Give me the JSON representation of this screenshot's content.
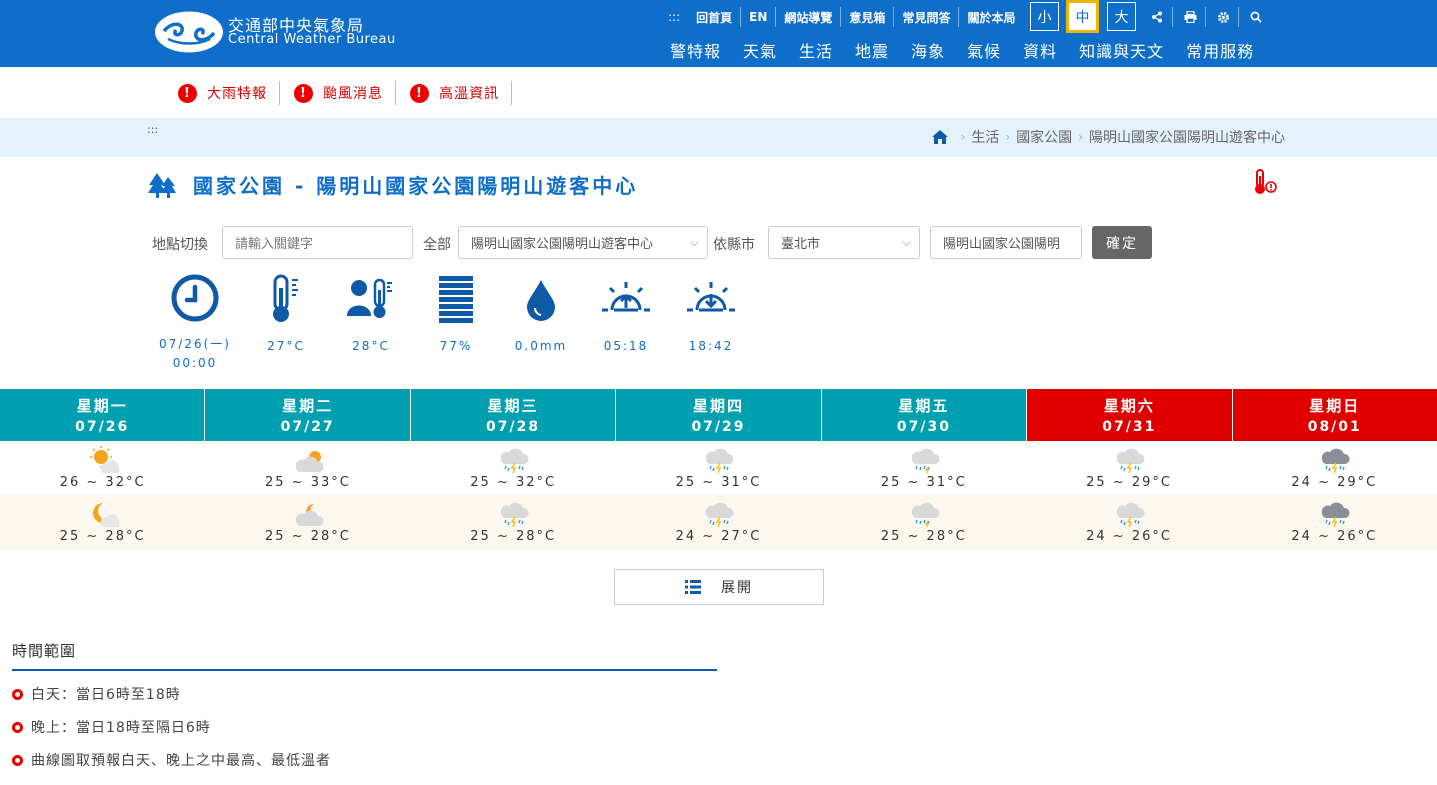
{
  "header": {
    "logo_zh": "交通部中央氣象局",
    "logo_en": "Central Weather Bureau",
    "accesskey": ":::",
    "top_links": [
      "回首頁",
      "EN",
      "網站導覽",
      "意見箱",
      "常見問答",
      "關於本局"
    ],
    "font_sizes": [
      "小",
      "中",
      "大"
    ],
    "active_font_size": "中",
    "tools": [
      "share-icon",
      "print-icon",
      "settings-icon",
      "search-icon"
    ],
    "main_nav": [
      "警特報",
      "天氣",
      "生活",
      "地震",
      "海象",
      "氣候",
      "資料",
      "知識與天文",
      "常用服務"
    ]
  },
  "alerts": [
    "大雨特報",
    "颱風消息",
    "高溫資訊"
  ],
  "breadcrumb": {
    "accesskey": ":::",
    "items": [
      "生活",
      "國家公園",
      "陽明山國家公園陽明山遊客中心"
    ]
  },
  "page": {
    "title": "國家公園 - 陽明山國家公園陽明山遊客中心"
  },
  "selector": {
    "label_location": "地點切換",
    "search_placeholder": "請輸入關鍵字",
    "label_all": "全部",
    "all_value": "陽明山國家公園陽明山遊客中心",
    "label_county": "依縣市",
    "county_value": "臺北市",
    "site_value": "陽明山國家公園陽明",
    "confirm_label": "確定"
  },
  "current": {
    "time": "07/26(一)",
    "time2": "00:00",
    "temp": "27°C",
    "feels_like": "28°C",
    "humidity": "77%",
    "rain": "0.0mm",
    "sunrise": "05:18",
    "sunset": "18:42"
  },
  "forecast": {
    "days": [
      {
        "name": "星期一",
        "date": "07/26",
        "weekend": false,
        "day_icon": "sunny-cloudy-icon",
        "day_temp": "26 ~ 32°C",
        "night_icon": "moon-cloudy-icon",
        "night_temp": "25 ~ 28°C"
      },
      {
        "name": "星期二",
        "date": "07/27",
        "weekend": false,
        "day_icon": "cloudy-sun-icon",
        "day_temp": "25 ~ 33°C",
        "night_icon": "cloudy-moon-icon",
        "night_temp": "25 ~ 28°C"
      },
      {
        "name": "星期三",
        "date": "07/28",
        "weekend": false,
        "day_icon": "thunder-rain-icon",
        "day_temp": "25 ~ 32°C",
        "night_icon": "thunder-rain-icon",
        "night_temp": "25 ~ 28°C"
      },
      {
        "name": "星期四",
        "date": "07/29",
        "weekend": false,
        "day_icon": "thunder-rain-icon",
        "day_temp": "25 ~ 31°C",
        "night_icon": "thunder-rain-icon",
        "night_temp": "24 ~ 27°C"
      },
      {
        "name": "星期五",
        "date": "07/30",
        "weekend": false,
        "day_icon": "rain-icon",
        "day_temp": "25 ~ 31°C",
        "night_icon": "rain-icon",
        "night_temp": "25 ~ 28°C"
      },
      {
        "name": "星期六",
        "date": "07/31",
        "weekend": true,
        "day_icon": "thunder-rain-icon",
        "day_temp": "25 ~ 29°C",
        "night_icon": "thunder-rain-icon",
        "night_temp": "24 ~ 26°C"
      },
      {
        "name": "星期日",
        "date": "08/01",
        "weekend": true,
        "day_icon": "dark-thunder-rain-icon",
        "day_temp": "24 ~ 29°C",
        "night_icon": "dark-thunder-rain-icon",
        "night_temp": "24 ~ 26°C"
      }
    ],
    "weekday_color": "#00a0b0",
    "weekend_color": "#e10000"
  },
  "expand_label": "展開",
  "notes": {
    "title": "時間範圍",
    "items": [
      "白天：當日6時至18時",
      "晚上：當日18時至隔日6時",
      "曲線圖取預報白天、晚上之中最高、最低溫者"
    ]
  }
}
